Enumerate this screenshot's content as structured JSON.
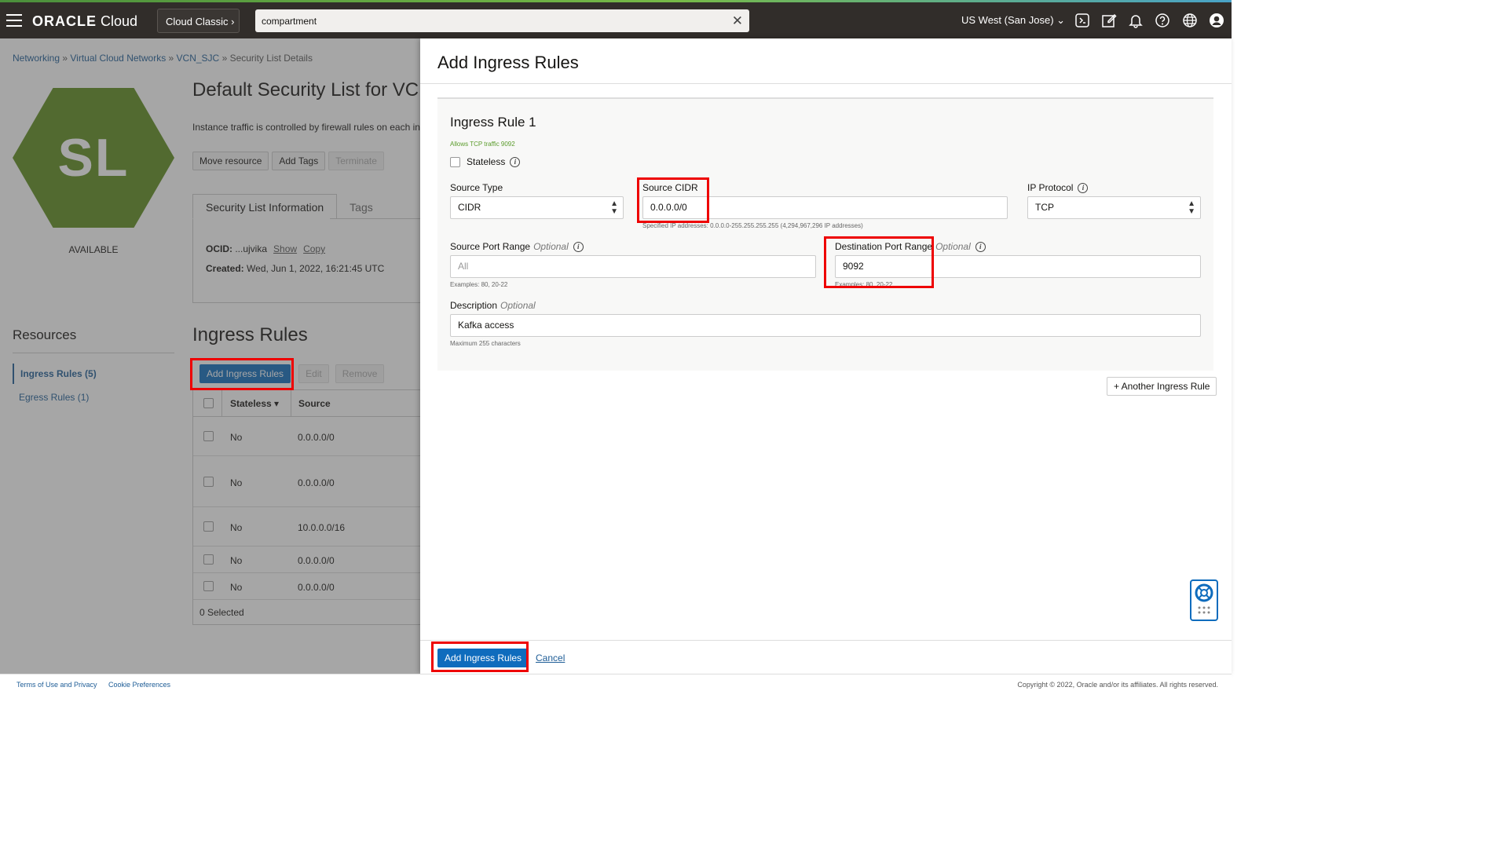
{
  "topbar": {
    "brand_bold": "ORACLE",
    "brand_rest": " Cloud",
    "classic_label": "Cloud Classic",
    "search_value": "compartment",
    "region_label": "US West (San Jose)"
  },
  "breadcrumb": {
    "items": [
      "Networking",
      "Virtual Cloud Networks",
      "VCN_SJC"
    ],
    "sep": " » ",
    "current": "Security List Details"
  },
  "resource": {
    "badge_letters": "SL",
    "status": "AVAILABLE",
    "title": "Default Security List for VCN",
    "intro": "Instance traffic is controlled by firewall rules on each inst",
    "actions": [
      "Move resource",
      "Add Tags",
      "Terminate"
    ],
    "tabs": [
      "Security List Information",
      "Tags"
    ],
    "ocid_label": "OCID:",
    "ocid_value": "...ujvika",
    "show_label": "Show",
    "copy_label": "Copy",
    "created_label": "Created:",
    "created_value": "Wed, Jun 1, 2022, 16:21:45 UTC"
  },
  "resources_nav": {
    "heading": "Resources",
    "items": [
      "Ingress Rules (5)",
      "Egress Rules (1)"
    ]
  },
  "ingress_list": {
    "heading": "Ingress Rules",
    "add_label": "Add Ingress Rules",
    "edit_label": "Edit",
    "remove_label": "Remove",
    "columns": [
      "Stateless",
      "Source"
    ],
    "rows": [
      {
        "stateless": "No",
        "source": "0.0.0.0/0"
      },
      {
        "stateless": "No",
        "source": "0.0.0.0/0"
      },
      {
        "stateless": "No",
        "source": "10.0.0.0/16"
      },
      {
        "stateless": "No",
        "source": "0.0.0.0/0"
      },
      {
        "stateless": "No",
        "source": "0.0.0.0/0"
      }
    ],
    "selected_text": "0 Selected"
  },
  "panel": {
    "title": "Add Ingress Rules",
    "rule_title": "Ingress Rule 1",
    "rule_hint": "Allows TCP traffic 9092",
    "stateless_label": "Stateless",
    "source_type_label": "Source Type",
    "source_type_value": "CIDR",
    "source_cidr_label": "Source CIDR",
    "source_cidr_value": "0.0.0.0/0",
    "source_cidr_help": "Specified IP addresses: 0.0.0.0-255.255.255.255 (4,294,967,296 IP addresses)",
    "ip_protocol_label": "IP Protocol",
    "ip_protocol_value": "TCP",
    "source_port_label": "Source Port Range",
    "optional": "Optional",
    "source_port_placeholder": "All",
    "source_port_help": "Examples: 80, 20-22",
    "dest_port_label": "Destination Port Range",
    "dest_port_value": "9092",
    "dest_port_help": "Examples: 80, 20-22",
    "description_label": "Description",
    "description_value": "Kafka access",
    "description_help": "Maximum 255 characters",
    "another_label": "+ Another Ingress Rule",
    "submit_label": "Add Ingress Rules",
    "cancel_label": "Cancel"
  },
  "footer": {
    "terms": "Terms of Use and Privacy",
    "cookies": "Cookie Preferences",
    "copyright": "Copyright © 2022, Oracle and/or its affiliates. All rights reserved."
  },
  "colors": {
    "topbar": "#312d2a",
    "primary": "#0f6cbd",
    "badge": "#5f8c1e",
    "highlight": "#e00000"
  }
}
